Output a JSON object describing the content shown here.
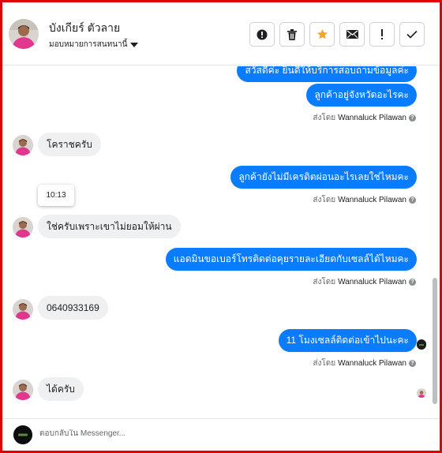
{
  "header": {
    "name": "บังเกียร์ ตัวลาย",
    "assign_label": "มอบหมายการสนทนานี้"
  },
  "toolbar": {
    "icons": [
      "alert-circle-icon",
      "trash-icon",
      "star-icon",
      "envelope-icon",
      "exclamation-icon",
      "check-icon"
    ],
    "accent": "#f5a623"
  },
  "thread": {
    "outgoing": [
      {
        "text": "สวัสดีค่ะ ยินดีให้บริการสอบถามข้อมูลค่ะ"
      },
      {
        "text": "ลูกค้าอยู่จังหวัดอะไรคะ"
      },
      {
        "text": "ลูกค้ายังไม่มีเครดิตผ่อนอะไรเลยใช่ไหมคะ"
      },
      {
        "text": "แอดมินขอเบอร์โทรติดต่อคุยรายละเอียดกับเซลล์ได้ไหมคะ"
      },
      {
        "text": "11 โมงเซลล์ติดต่อเข้าไปนะคะ"
      }
    ],
    "incoming": [
      {
        "text": "โคราชครับ"
      },
      {
        "text": "ใช่ครับเพราะเขาไม่ยอมให้ผ่าน"
      },
      {
        "text": "0640933169"
      },
      {
        "text": "ได้ครับ"
      }
    ],
    "sent_by_prefix": "ส่งโดย",
    "sent_by_name": "Wannaluck Pilawan",
    "tooltip_time": "10:13"
  },
  "composer": {
    "placeholder": "ตอบกลับใน Messenger..."
  },
  "colors": {
    "outgoing_bubble": "#0a7cff",
    "incoming_bubble": "#eff0f2",
    "frame_border": "#e00000"
  }
}
